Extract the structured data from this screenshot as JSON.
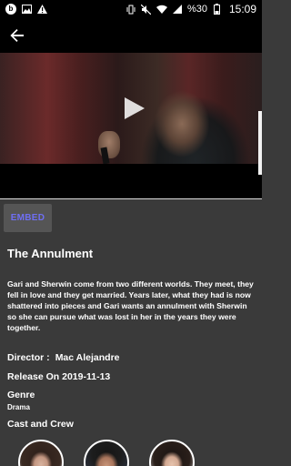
{
  "status_bar": {
    "icons_left": [
      "b-notification-icon",
      "image-icon",
      "warning-icon"
    ],
    "icons_right": [
      "vibrate-icon",
      "mute-icon",
      "wifi-icon",
      "signal-icon"
    ],
    "battery_text": "%30",
    "time": "15:09"
  },
  "app_bar": {
    "back_icon": "arrow-back-icon"
  },
  "video": {
    "play_icon": "play-icon"
  },
  "movie": {
    "embed_label": "EMBED",
    "title": "The Annulment",
    "description": "Gari and Sherwin come from two different worlds. They meet, they fell in love and they get married. Years later, what they had is now shattered into pieces and Gari wants an annulment with Sherwin so she can pursue what was lost in her in the years they were together.",
    "director_label": "Director :",
    "director_value": "Mac Alejandre",
    "release_text": "Release On 2019-11-13",
    "genre_label": "Genre",
    "genre_value": "Drama",
    "cast_label": "Cast and Crew"
  },
  "colors": {
    "embed_text": "#6f6ff3",
    "background": "#3a3a3a",
    "bar": "#000000"
  }
}
